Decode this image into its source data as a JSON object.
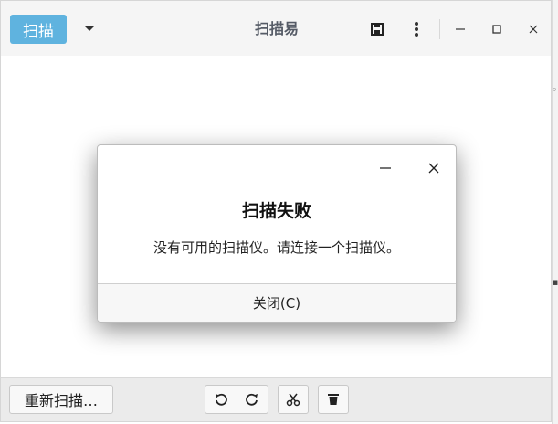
{
  "header": {
    "scan_label": "扫描",
    "title": "扫描易",
    "icons": {
      "dropdown": "chevron-down-icon",
      "save": "save-icon",
      "menu": "more-vertical-icon",
      "minimize": "minimize-icon",
      "maximize": "maximize-icon",
      "close": "close-icon"
    }
  },
  "dialog": {
    "title": "扫描失败",
    "message": "没有可用的扫描仪。请连接一个扫描仪。",
    "close_label": "关闭(C)"
  },
  "footer": {
    "rescan_label": "重新扫描…",
    "tools": [
      "rotate-left-icon",
      "rotate-right-icon",
      "crop-icon",
      "delete-icon"
    ]
  },
  "colors": {
    "accent": "#5fb3df",
    "header_bg": "#f5f5f5",
    "footer_bg": "#ebebeb"
  }
}
